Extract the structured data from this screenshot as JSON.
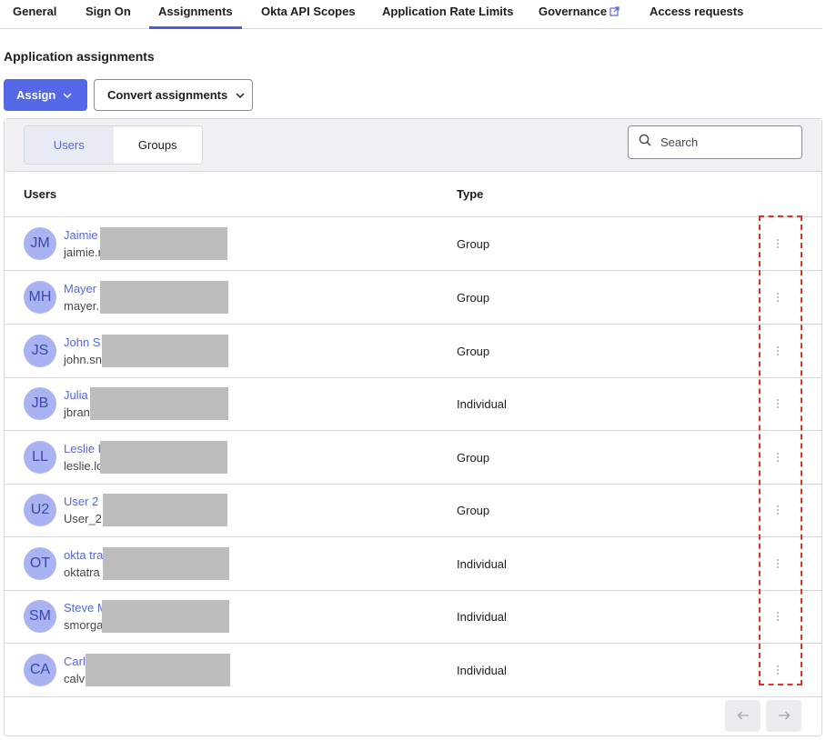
{
  "tabs": [
    {
      "label": "General",
      "active": false
    },
    {
      "label": "Sign On",
      "active": false
    },
    {
      "label": "Assignments",
      "active": true
    },
    {
      "label": "Okta API Scopes",
      "active": false
    },
    {
      "label": "Application Rate Limits",
      "active": false
    },
    {
      "label": "Governance",
      "active": false,
      "icon": "external-link-icon"
    },
    {
      "label": "Access requests",
      "active": false
    }
  ],
  "section_title": "Application assignments",
  "actions": {
    "assign_label": "Assign",
    "convert_label": "Convert assignments"
  },
  "filter": {
    "users_label": "Users",
    "groups_label": "Groups",
    "selected": "Users"
  },
  "search": {
    "placeholder": "Search",
    "value": ""
  },
  "table": {
    "columns": [
      "Users",
      "Type"
    ],
    "rows": [
      {
        "initials": "JM",
        "name": "Jaimie",
        "email": "jaimie.r",
        "type": "Group"
      },
      {
        "initials": "MH",
        "name": "Mayer",
        "email": "mayer.",
        "type": "Group"
      },
      {
        "initials": "JS",
        "name": "John S",
        "email": "john.sn",
        "type": "Group"
      },
      {
        "initials": "JB",
        "name": "Julia",
        "email": "jbran",
        "type": "Individual"
      },
      {
        "initials": "LL",
        "name": "Leslie L",
        "email": "leslie.lo",
        "type": "Group"
      },
      {
        "initials": "U2",
        "name": "User 2",
        "email": "User_2",
        "type": "Group"
      },
      {
        "initials": "OT",
        "name": "okta tra",
        "email": "oktatra",
        "type": "Individual"
      },
      {
        "initials": "SM",
        "name": "Steve M",
        "email": "smorga",
        "type": "Individual"
      },
      {
        "initials": "CA",
        "name": "Carl",
        "email": "calv",
        "type": "Individual"
      }
    ]
  },
  "pagination": {
    "prev_icon": "arrow-left-icon",
    "next_icon": "arrow-right-icon"
  },
  "colors": {
    "accent": "#5468e8",
    "avatar_bg": "#a9b3f2",
    "highlight_dash": "#e0331f"
  }
}
